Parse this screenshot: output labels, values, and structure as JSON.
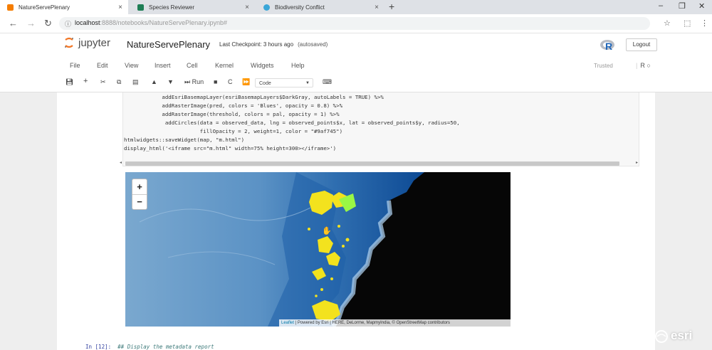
{
  "browser": {
    "tabs": [
      {
        "title": "NatureServePlenary",
        "close": "×",
        "color": "#f57d00",
        "active": true
      },
      {
        "title": "Species Reviewer",
        "close": "×",
        "color": "#1e7e55",
        "active": false
      },
      {
        "title": "Biodiversity Conflict",
        "close": "×",
        "color": "#3aa6d8",
        "active": false
      }
    ],
    "new_tab": "+",
    "window_controls": {
      "minimize": "–",
      "maximize": "❐",
      "close": "✕"
    },
    "nav": {
      "back": "←",
      "forward": "→",
      "reload": "↻"
    },
    "url_host": "localhost",
    "url_rest": ":8888/notebooks/NatureServePlenary.ipynb#"
  },
  "jupyter": {
    "logo_text": "jupyter",
    "notebook_title": "NatureServePlenary",
    "checkpoint": "Last Checkpoint: 3 hours ago",
    "autosaved": "(autosaved)",
    "kernel_logo": "R",
    "logout_label": "Logout",
    "menu": [
      "File",
      "Edit",
      "View",
      "Insert",
      "Cell",
      "Kernel",
      "Widgets",
      "Help"
    ],
    "trusted": "Trusted",
    "kernel_name": "R",
    "toolbar": {
      "run_label": "Run",
      "cell_type": "Code"
    }
  },
  "cell": {
    "code_lines": [
      "            addEsriBasemapLayer(esriBasemapLayers$DarkGray, autoLabels = TRUE) %>%",
      "            addRasterImage(pred, colors = 'Blues', opacity = 0.8) %>%",
      "            addRasterImage(threshold, colors = pal, opacity = 1) %>%",
      "             addCircles(data = observed_data, lng = observed_points$x, lat = observed_points$y, radius=50,",
      "                        fillOpacity = 2, weight=1, color = \"#9af745\")",
      "htmlwidgets::saveWidget(map, \"m.html\")",
      "display_html('<iframe src=\"m.html\" width=75% height=300></iframe>')"
    ]
  },
  "map": {
    "zoom_in": "+",
    "zoom_out": "−",
    "attribution_link": "Leaflet",
    "attribution_text": " | Powered by Esri | HERE, DeLorme, MapmyIndia, © OpenStreetMap contributors",
    "observation_color": "#f3e21e",
    "observation_highlight": "#9af745"
  },
  "next_cell": {
    "prompt": "In [12]:",
    "comment": "## Display the metadata report"
  },
  "watermark": {
    "brand": "esri"
  }
}
